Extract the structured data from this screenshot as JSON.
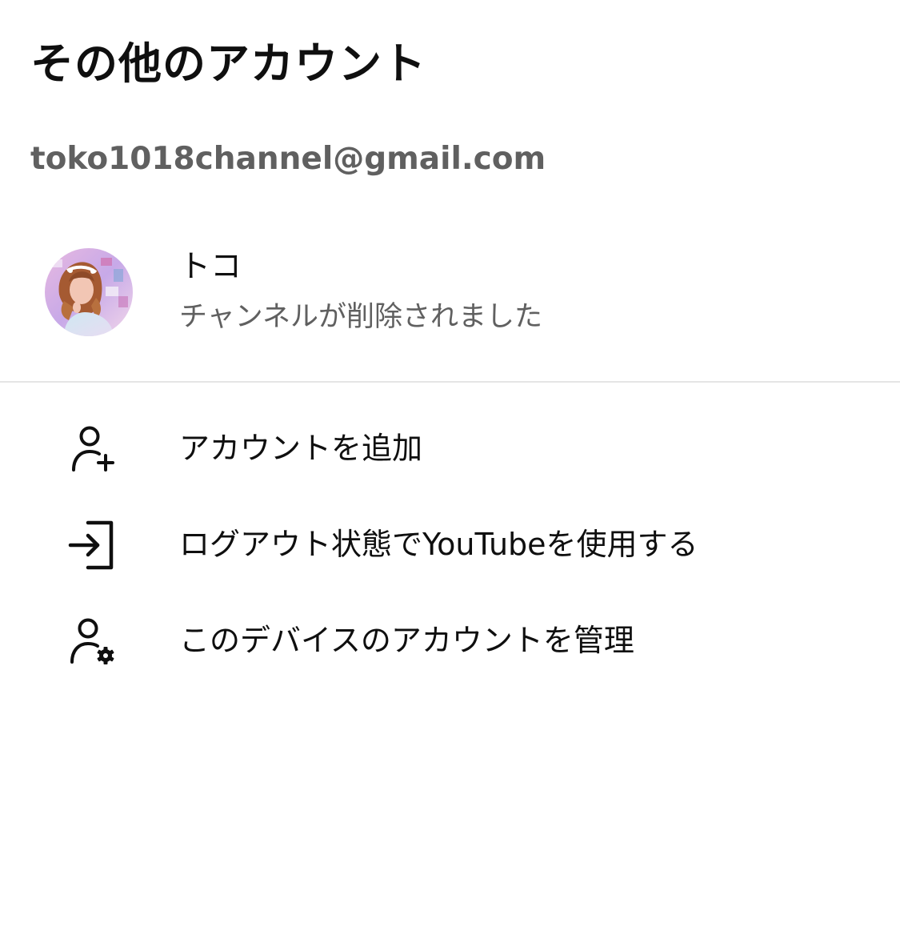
{
  "header": {
    "title": "その他のアカウント"
  },
  "account": {
    "email": "toko1018channel@gmail.com"
  },
  "channel": {
    "name": "トコ",
    "status": "チャンネルが削除されました",
    "avatar_icon": "profile-photo"
  },
  "menu": {
    "items": [
      {
        "label": "アカウントを追加",
        "icon": "person-add-icon"
      },
      {
        "label": "ログアウト状態でYouTubeを使用する",
        "icon": "sign-in-arrow-icon"
      },
      {
        "label": "このデバイスのアカウントを管理",
        "icon": "person-settings-icon"
      }
    ]
  },
  "colors": {
    "text_primary": "#0f0f0f",
    "text_secondary": "#606060",
    "divider": "#e5e5e5",
    "background": "#ffffff"
  }
}
